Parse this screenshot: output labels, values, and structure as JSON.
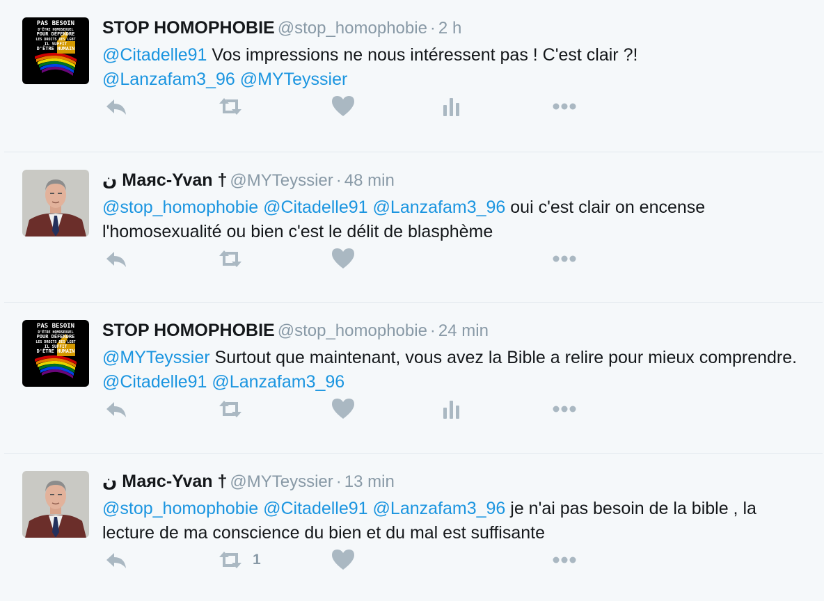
{
  "tweets": [
    {
      "author": {
        "name": "STOP HOMOPHOBIE",
        "handle": "@stop_homophobie",
        "avatar": "stop-homophobie-logo"
      },
      "time": "2 h",
      "segments": [
        {
          "text": "@Citadelle91",
          "mention": true
        },
        {
          "text": " Vos impressions ne nous intéressent pas ! C'est clair ?!",
          "mention": false
        },
        {
          "text": "\n",
          "mention": false
        },
        {
          "text": "@Lanzafam3_96",
          "mention": true
        },
        {
          "text": " ",
          "mention": false
        },
        {
          "text": "@MYTeyssier",
          "mention": true
        }
      ],
      "actions": {
        "reply": "reply-icon",
        "retweet": "retweet-icon",
        "like": "heart-icon",
        "analytics": "analytics-icon",
        "more": "more-icon"
      },
      "retweet_count": ""
    },
    {
      "author": {
        "name_prefix": "ن",
        "name": "Маяс-Yvan",
        "name_suffix": "†",
        "handle": "@MYTeyssier",
        "avatar": "man-portrait"
      },
      "time": "48 min",
      "segments": [
        {
          "text": "@stop_homophobie",
          "mention": true
        },
        {
          "text": " ",
          "mention": false
        },
        {
          "text": "@Citadelle91",
          "mention": true
        },
        {
          "text": " ",
          "mention": false
        },
        {
          "text": "@Lanzafam3_96",
          "mention": true
        },
        {
          "text": " oui c'est clair on encense l'homosexualité ou bien c'est le délit de blasphème",
          "mention": false
        }
      ],
      "actions": {
        "reply": "reply-icon",
        "retweet": "retweet-icon",
        "like": "heart-icon",
        "more": "more-icon"
      },
      "retweet_count": ""
    },
    {
      "author": {
        "name": "STOP HOMOPHOBIE",
        "handle": "@stop_homophobie",
        "avatar": "stop-homophobie-logo"
      },
      "time": "24 min",
      "segments": [
        {
          "text": "@MYTeyssier",
          "mention": true
        },
        {
          "text": " Surtout que maintenant, vous avez la Bible a relire pour mieux comprendre. ",
          "mention": false
        },
        {
          "text": "@Citadelle91",
          "mention": true
        },
        {
          "text": " ",
          "mention": false
        },
        {
          "text": "@Lanzafam3_96",
          "mention": true
        }
      ],
      "actions": {
        "reply": "reply-icon",
        "retweet": "retweet-icon",
        "like": "heart-icon",
        "analytics": "analytics-icon",
        "more": "more-icon"
      },
      "retweet_count": ""
    },
    {
      "author": {
        "name_prefix": "ن",
        "name": "Маяс-Yvan",
        "name_suffix": "†",
        "handle": "@MYTeyssier",
        "avatar": "man-portrait"
      },
      "time": "13 min",
      "segments": [
        {
          "text": "@stop_homophobie",
          "mention": true
        },
        {
          "text": " ",
          "mention": false
        },
        {
          "text": "@Citadelle91",
          "mention": true
        },
        {
          "text": " ",
          "mention": false
        },
        {
          "text": "@Lanzafam3_96",
          "mention": true
        },
        {
          "text": " je n'ai pas besoin de la bible , la lecture de ma conscience du bien et du mal est suffisante",
          "mention": false
        }
      ],
      "actions": {
        "reply": "reply-icon",
        "retweet": "retweet-icon",
        "like": "heart-icon",
        "more": "more-icon"
      },
      "retweet_count": "1"
    }
  ],
  "logo_text": [
    "PAS BESOIN",
    "D'ÊTRE HOMOSEXUEL",
    "POUR DÉFENDRE",
    "LES DROITS DES LGBT",
    "IL SUFFIT",
    "D'ÊTRE HUMAIN"
  ],
  "colors": {
    "mention": "#1b95e0",
    "text": "#14171a",
    "muted": "#8899a6",
    "icon": "#aab8c2",
    "background": "#f5f8fa",
    "divider": "#e1e8ed"
  }
}
